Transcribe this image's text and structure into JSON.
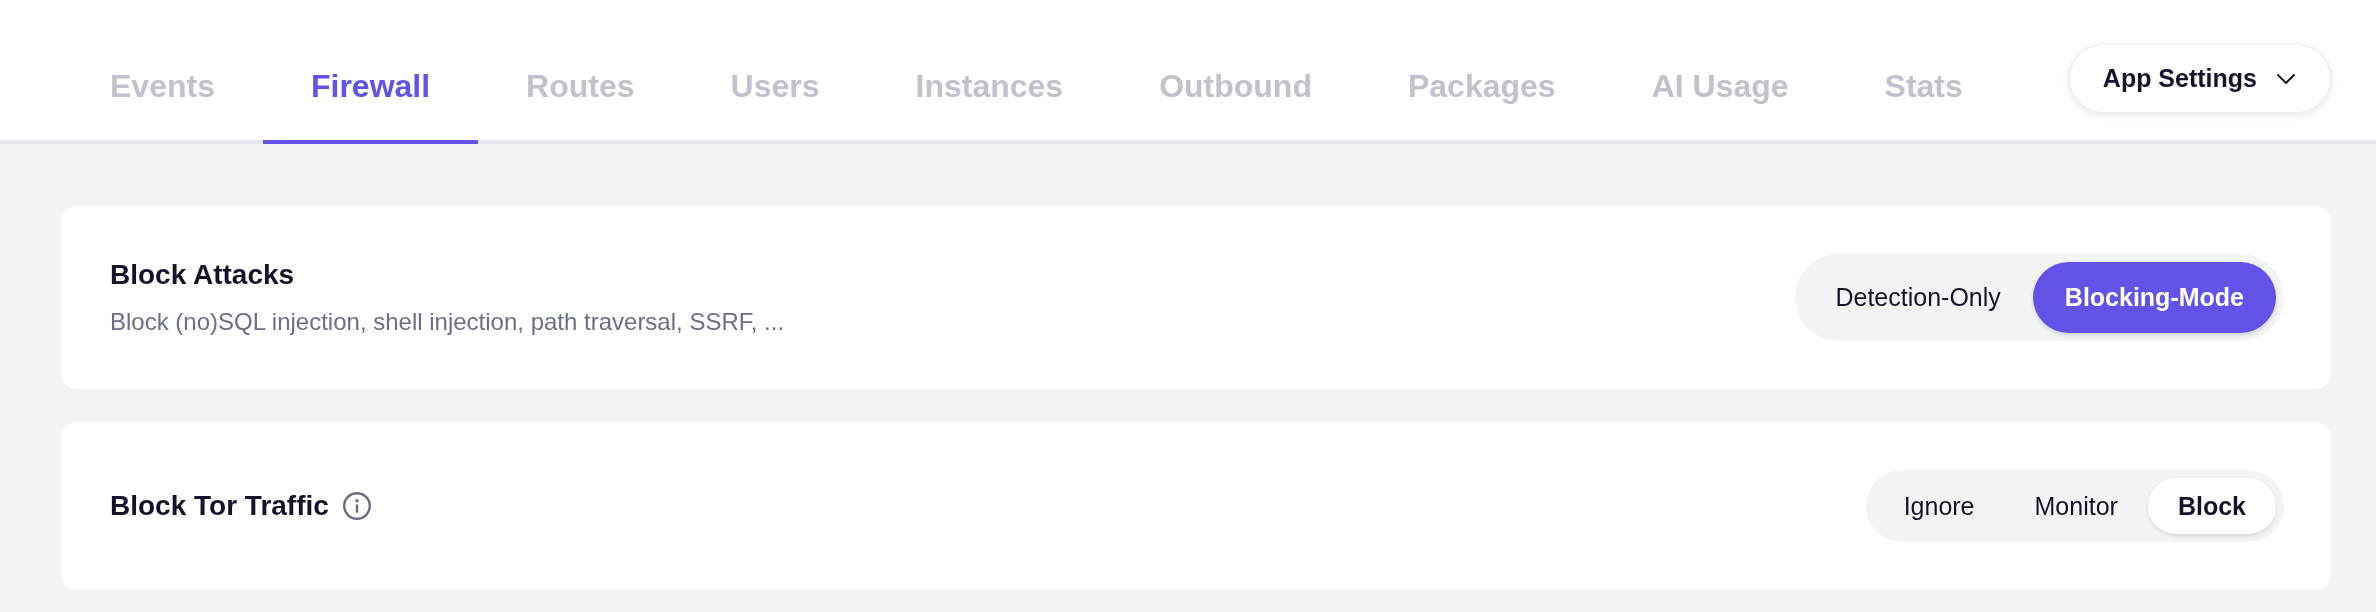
{
  "tabs": [
    {
      "label": "Events",
      "selected": false
    },
    {
      "label": "Firewall",
      "selected": true
    },
    {
      "label": "Routes",
      "selected": false
    },
    {
      "label": "Users",
      "selected": false
    },
    {
      "label": "Instances",
      "selected": false
    },
    {
      "label": "Outbound",
      "selected": false
    },
    {
      "label": "Packages",
      "selected": false
    },
    {
      "label": "AI Usage",
      "selected": false
    },
    {
      "label": "Stats",
      "selected": false
    }
  ],
  "app_settings": {
    "label": "App Settings"
  },
  "cards": [
    {
      "title": "Block Attacks",
      "info_icon": false,
      "description": "Block (no)SQL injection, shell injection, path traversal, SSRF, ...",
      "control": {
        "kind": "accent",
        "options": [
          {
            "label": "Detection-Only",
            "selected": false
          },
          {
            "label": "Blocking-Mode",
            "selected": true
          }
        ]
      }
    },
    {
      "title": "Block Tor Traffic",
      "info_icon": true,
      "control": {
        "kind": "plain",
        "options": [
          {
            "label": "Ignore",
            "selected": false
          },
          {
            "label": "Monitor",
            "selected": false
          },
          {
            "label": "Block",
            "selected": true
          }
        ]
      }
    }
  ]
}
